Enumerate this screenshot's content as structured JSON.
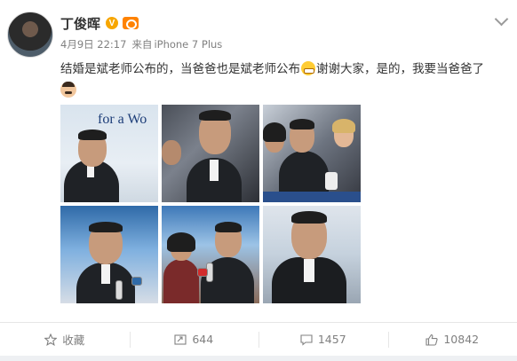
{
  "post": {
    "author": "丁俊晖",
    "verified_badge": "V",
    "date": "4月9日 22:17",
    "source_prefix": "来自",
    "source": "iPhone 7 Plus",
    "text_part1": "结婚是斌老师公布的，当爸爸也是斌老师公布",
    "text_part2": "谢谢大家，是的，我要当爸爸了",
    "emoji_1": "grin-emoji",
    "emoji_2": "man-face-emoji"
  },
  "photos": {
    "p1_slogan": "for a Wo"
  },
  "actions": {
    "favorite_label": "收藏",
    "repost_count": "644",
    "comment_count": "1457",
    "like_count": "10842"
  },
  "colors": {
    "verified": "#f7a600",
    "level_badge": "#ff8200",
    "meta_text": "#808080"
  }
}
